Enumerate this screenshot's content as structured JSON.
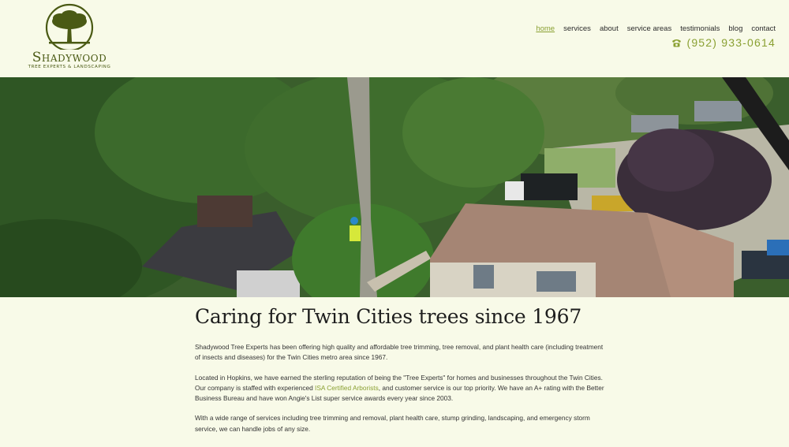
{
  "brand": {
    "name": "Shadywood",
    "tagline": "TREE EXPERTS & LANDSCAPING",
    "accent": "#8aa032",
    "logo_color": "#4a5a14"
  },
  "nav": {
    "items": [
      {
        "label": "home",
        "active": true
      },
      {
        "label": "services"
      },
      {
        "label": "about"
      },
      {
        "label": "service areas"
      },
      {
        "label": "testimonials"
      },
      {
        "label": "blog"
      },
      {
        "label": "contact"
      }
    ]
  },
  "contact": {
    "phone": "(952) 933-0614",
    "phone_icon": "phone-icon"
  },
  "hero": {
    "image": "aerial-tree-trimming-photo"
  },
  "main": {
    "heading": "Caring for Twin Cities trees since 1967",
    "p1": "Shadywood Tree Experts has been offering high quality and affordable tree trimming, tree removal, and plant health care (including treatment of insects and diseases) for the Twin Cities metro area since 1967.",
    "p2_before": "Located in Hopkins, we have earned the sterling reputation of being the \"Tree Experts\" for homes and businesses throughout the Twin Cities. Our company is staffed with experienced ",
    "p2_link": "ISA Certified Arborists",
    "p2_after": ", and customer service is our top priority. We have an A+ rating with the Better Business Bureau and have won Angie's List super service awards every year since 2003.",
    "p3": "With a wide range of services including tree trimming and removal, plant health care, stump grinding, landscaping, and emergency storm service, we can handle jobs of any size."
  }
}
